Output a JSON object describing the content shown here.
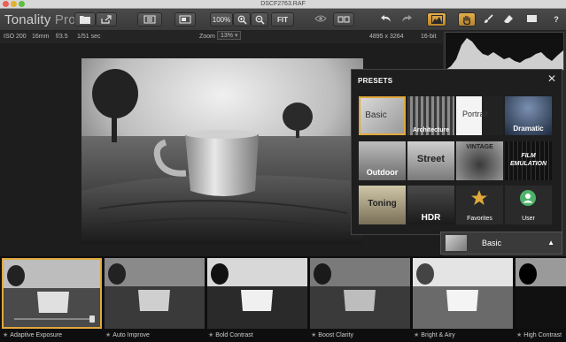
{
  "window": {
    "title": "DSCF2763.RAF"
  },
  "app": {
    "name": "Tonality",
    "suffix": " Pro"
  },
  "toolbar": {
    "zoom_percent": "100%",
    "fit_label": "FIT",
    "help_label": "?"
  },
  "infobar": {
    "iso": "ISO 200",
    "focal": "16mm",
    "aperture": "f/3.5",
    "shutter": "1/51 sec",
    "zoom_label": "Zoom",
    "zoom_value": "13%",
    "dimensions": "4895 x 3264",
    "bitdepth": "16-bit"
  },
  "presets": {
    "title": "PRESETS",
    "close": "✕",
    "tiles": [
      {
        "label": "Basic"
      },
      {
        "label": "Architecture"
      },
      {
        "label": "Portrait"
      },
      {
        "label": "Dramatic"
      },
      {
        "label": "Outdoor"
      },
      {
        "label": "Street"
      },
      {
        "label": "VINTAGE"
      },
      {
        "label": "FILM EMULATION"
      },
      {
        "label": "Toning"
      },
      {
        "label": "HDR"
      },
      {
        "label": "Favorites"
      },
      {
        "label": "User"
      }
    ]
  },
  "basic_panel": {
    "label": "Basic",
    "arrow": "▲"
  },
  "filmstrip": {
    "items": [
      {
        "label": "Adaptive Exposure"
      },
      {
        "label": "Auto Improve"
      },
      {
        "label": "Bold Contrast"
      },
      {
        "label": "Boost Clarity"
      },
      {
        "label": "Bright & Airy"
      },
      {
        "label": "High Contrast"
      }
    ]
  },
  "colors": {
    "accent": "#e0a83c",
    "background": "#1b1b1b",
    "toolbar": "#3f3f3f"
  },
  "icons": [
    "folder-icon",
    "share-icon",
    "compare-icon",
    "split-view-icon",
    "zoom-in-icon",
    "zoom-out-icon",
    "eye-icon",
    "side-by-side-icon",
    "undo-icon",
    "redo-icon",
    "histogram-icon",
    "hand-icon",
    "brush-icon",
    "eraser-icon",
    "mask-icon",
    "help-icon",
    "star-icon",
    "user-icon"
  ]
}
